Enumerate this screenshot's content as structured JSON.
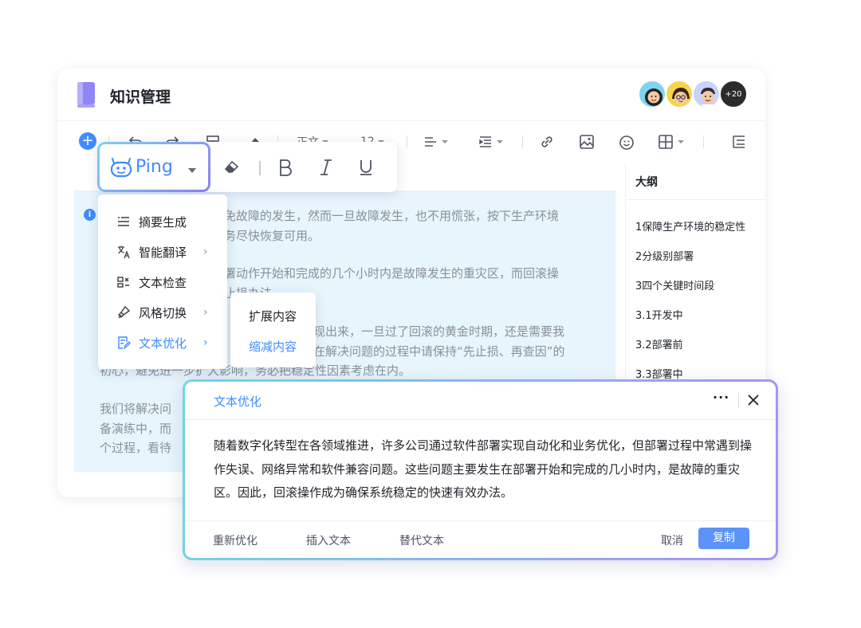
{
  "app": {
    "title": "知识管理",
    "more_collaborators": "+20"
  },
  "toolbar": {
    "font_family": "正文",
    "font_size": "12"
  },
  "outline": {
    "title": "大纲",
    "items": [
      "1保障生产环境的稳定性",
      "2分级别部署",
      "3四个关键时间段",
      "3.1开发中",
      "3.2部署前",
      "3.3部署中"
    ]
  },
  "document": {
    "paragraphs": [
      [
        "免故障的发生，然而一旦故障发生，也不用慌张，按下生产环境",
        "务尽快恢复可用。"
      ],
      [
        "署动作开始和完成的几个小时内是故障发生的重灾区，而回滚操",
        "止损办法。"
      ],
      [
        "现出来，一旦过了回滚的黄金时期，还是需要我",
        "在解决问题的过程中请保持“先止损、再查因”的",
        "初心，避免进一步扩大影响，务必把稳定性因素考虑在内。"
      ],
      [
        "我们将解决问",
        "备演练中，而",
        "个过程，看待"
      ]
    ]
  },
  "ping": {
    "label": "Ping"
  },
  "menu": {
    "items": [
      {
        "label": "摘要生成",
        "has_submenu": false
      },
      {
        "label": "智能翻译",
        "has_submenu": true
      },
      {
        "label": "文本检查",
        "has_submenu": false
      },
      {
        "label": "风格切换",
        "has_submenu": true
      },
      {
        "label": "文本优化",
        "has_submenu": true,
        "active": true
      }
    ],
    "arrow": "›"
  },
  "submenu": {
    "items": [
      "扩展内容",
      "缩减内容"
    ]
  },
  "dialog": {
    "title": "文本优化",
    "more": "···",
    "body": "随着数字化转型在各领域推进，许多公司通过软件部署实现自动化和业务优化，但部署过程中常遇到操作失误、网络异常和软件兼容问题。这些问题主要发生在部署开始和完成的几小时内，是故障的重灾区。因此，回滚操作成为确保系统稳定的快速有效办法。",
    "actions": {
      "reoptimize": "重新优化",
      "insert": "插入文本",
      "replace": "替代文本",
      "cancel": "取消",
      "copy": "复制"
    }
  },
  "colors": {
    "accent": "#3f8cff",
    "highlight": "#e7f5fd",
    "gradient_start": "#6fd6e6",
    "gradient_end": "#a991f6"
  }
}
